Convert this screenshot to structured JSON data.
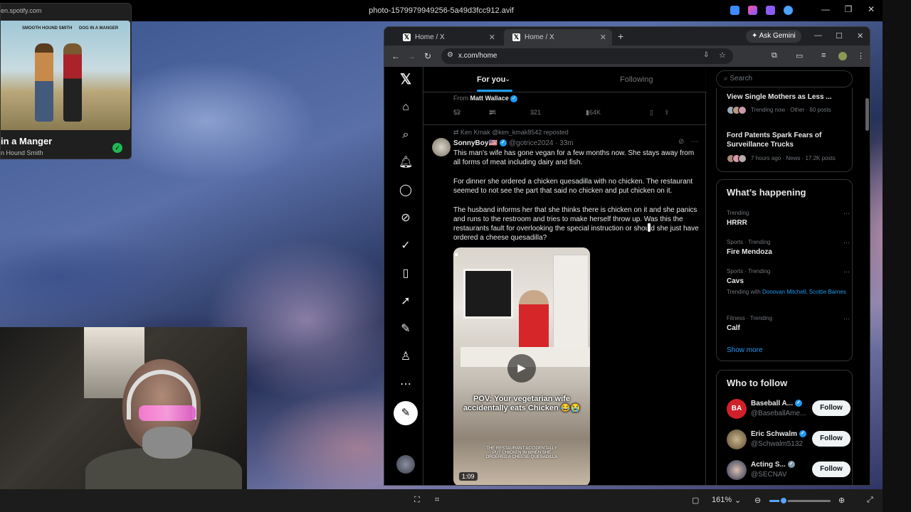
{
  "window": {
    "title": "photo-1579979949256-5a49d3fcc912.avif"
  },
  "spotify": {
    "url": "en.spotify.com",
    "album_tag_left": "SMOOTH HOUND SMITH",
    "album_tag_right": "DOG IN A MANGER",
    "song": "in a Manger",
    "artist": "n Hound Smith"
  },
  "viewer": {
    "zoom": "161%",
    "zoom_level": 0.23
  },
  "browser": {
    "tabs": [
      {
        "label": "Home / X"
      },
      {
        "label": "Home / X"
      }
    ],
    "gemini": "Ask Gemini",
    "url": "x.com/home"
  },
  "x": {
    "tab_foryou": "For you",
    "tab_following": "Following",
    "prev_post": {
      "from": "From",
      "from_name": "Matt Wallace",
      "replies": "52",
      "reposts": "34",
      "likes": "321",
      "views": "164K"
    },
    "post": {
      "repost_line": "Ken Kmak @ken_kmak8542 reposted",
      "name": "SonnyBoy🇺🇸",
      "handle": "@gotrice2024 · 33m",
      "p1": "This man's wife has gone vegan for a few months now. She stays away from all forms of meat including dairy and fish.",
      "p2": "For dinner she ordered a chicken quesadilla with no chicken. The restaurant seemed to not see the part that said no chicken and put chicken on it.",
      "p3": "The husband informs her that she thinks there is chicken on it and she panics and runs to the restroom and tries to make herself throw up. Was this the restaurants fault for overlooking the special instruction or should she just have ordered a cheese quesadilla?",
      "video_caption": "POV: Your vegetarian wife accidentally eats Chicken 😂😭",
      "video_sub": "THE RESTAURANT ACCIDENTALLY PUT CHICKEN IN WHEN SHE ORDERED A CHEESE QUESADILLA",
      "video_duration": "1:09"
    },
    "search_placeholder": "Search",
    "trends_top": [
      {
        "title": "View Single Mothers as Less ...",
        "meta": "Trending now · Other · 60 posts"
      },
      {
        "title": "Ford Patents Spark Fears of Surveillance Trucks",
        "meta": "7 hours ago · News · 17.2K posts"
      }
    ],
    "happening": {
      "heading": "What’s happening",
      "items": [
        {
          "meta": "Trending",
          "title": "HRRR"
        },
        {
          "meta": "Sports · Trending",
          "title": "Fire Mendoza"
        },
        {
          "meta": "Sports · Trending",
          "title": "Cavs",
          "extra_label": "Trending with",
          "extra_links": "Donovan Mitchell, Scottie Barnes"
        },
        {
          "meta": "Fitness · Trending",
          "title": "Calf"
        }
      ],
      "show_more": "Show more"
    },
    "who_to_follow": {
      "heading": "Who to follow",
      "items": [
        {
          "name": "Baseball A...",
          "handle": "@BaseballAme...",
          "button": "Follow",
          "avatar_text": "BA"
        },
        {
          "name": "Eric Schwalm",
          "handle": "@Schwalm5132",
          "button": "Follow"
        },
        {
          "name": "Acting S...",
          "handle": "@SECNAV",
          "button": "Follow"
        }
      ]
    }
  }
}
